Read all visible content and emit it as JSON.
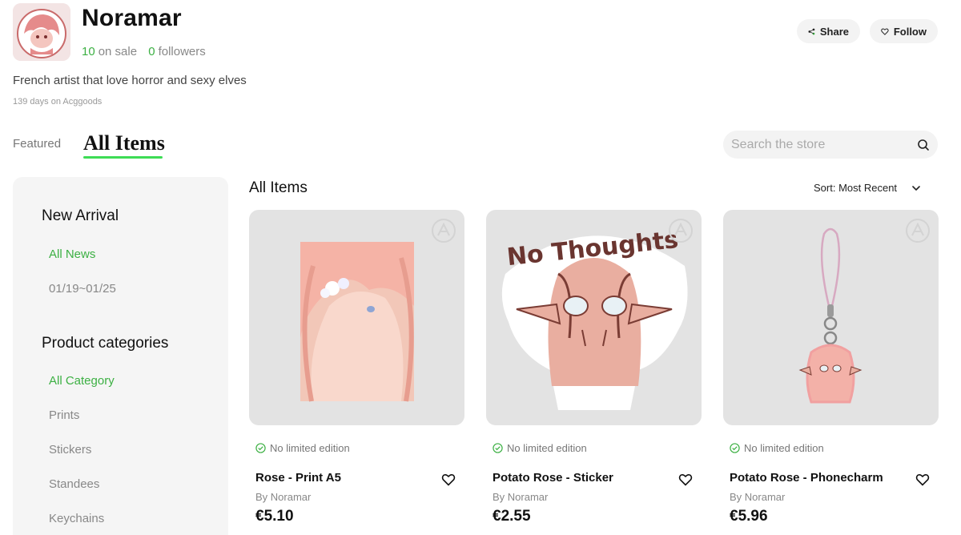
{
  "store": {
    "name": "Noramar",
    "on_sale_count": "10",
    "on_sale_label": "on sale",
    "followers_count": "0",
    "followers_label": "followers",
    "bio": "French artist that love horror and sexy elves",
    "days": "139 days on Acggoods"
  },
  "header": {
    "share_label": "Share",
    "follow_label": "Follow"
  },
  "tabs": {
    "featured": "Featured",
    "all_items": "All Items"
  },
  "search": {
    "placeholder": "Search the store"
  },
  "sidebar": {
    "new_arrival": {
      "heading": "New Arrival",
      "items": [
        "All News",
        "01/19~01/25"
      ]
    },
    "categories": {
      "heading": "Product categories",
      "items": [
        "All Category",
        "Prints",
        "Stickers",
        "Standees",
        "Keychains"
      ]
    }
  },
  "main": {
    "title": "All Items",
    "sort_label": "Sort: Most Recent"
  },
  "products": [
    {
      "limited": "No limited edition",
      "name": "Rose - Print A5",
      "by": "By Noramar",
      "price": "€5.10"
    },
    {
      "limited": "No limited edition",
      "name": "Potato Rose - Sticker",
      "by": "By Noramar",
      "price": "€2.55"
    },
    {
      "limited": "No limited edition",
      "name": "Potato Rose - Phonecharm",
      "by": "By Noramar",
      "price": "€5.96"
    }
  ],
  "sticker_text": "No Thoughts",
  "colors": {
    "accent_green": "#3cb043",
    "tab_underline": "#3ddc55",
    "card_bg": "#e3e3e3",
    "sidebar_bg": "#f5f5f5"
  },
  "icons": {
    "share": "share-icon",
    "follow": "heart-icon",
    "search": "search-icon",
    "sort": "chevron-down-icon",
    "limited": "check-circle-icon",
    "wishlist": "heart-outline-icon",
    "watermark": "acggoods-logo-icon"
  }
}
